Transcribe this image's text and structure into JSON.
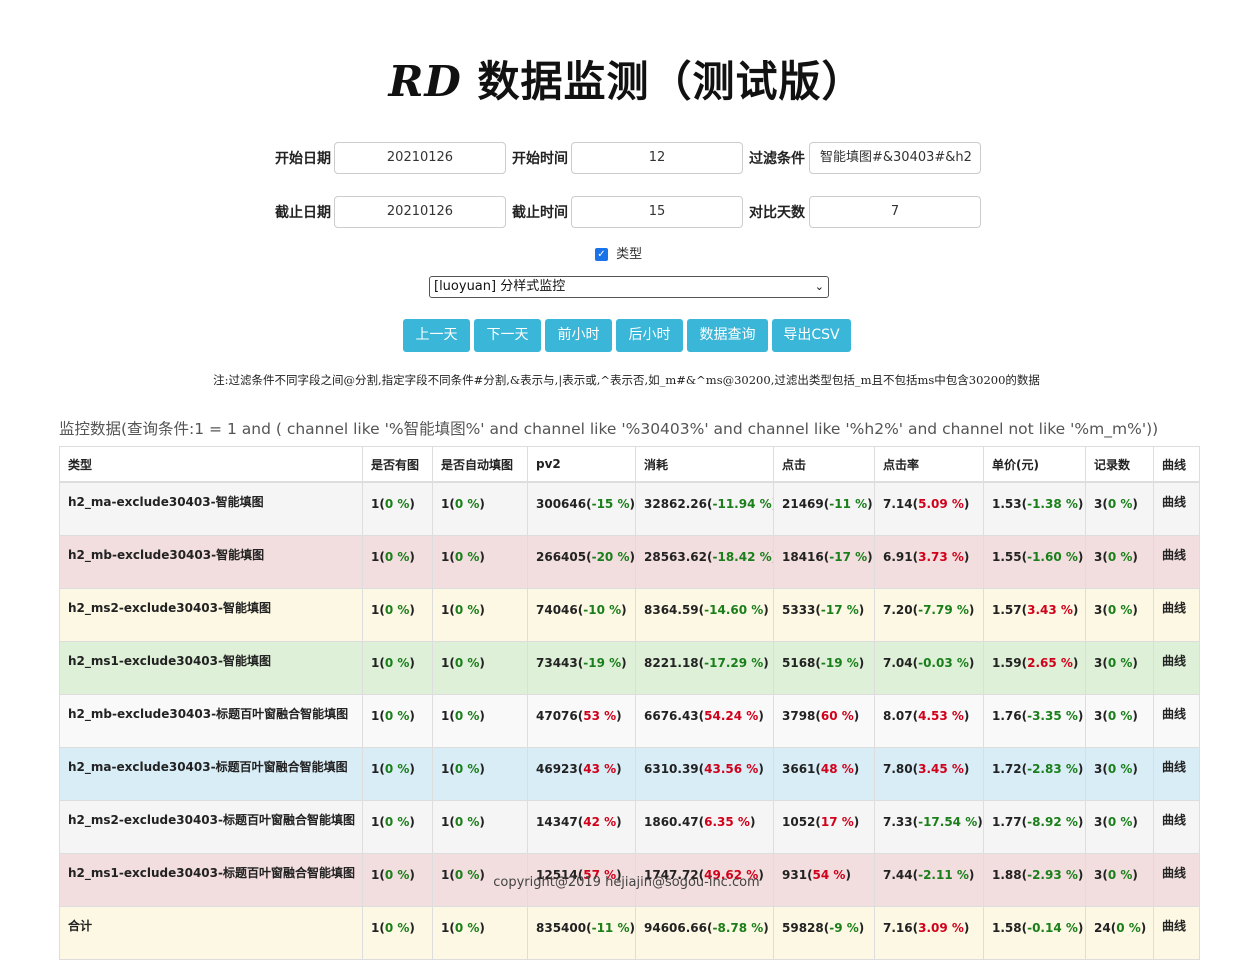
{
  "title": {
    "rd": "RD",
    "main": "数据监测（测试版）"
  },
  "form": {
    "start_date": {
      "label": "开始日期",
      "value": "20210126"
    },
    "start_time": {
      "label": "开始时间",
      "value": "12"
    },
    "filter": {
      "label": "过滤条件",
      "value": "智能填图#&30403#&h2"
    },
    "end_date": {
      "label": "截止日期",
      "value": "20210126"
    },
    "end_time": {
      "label": "截止时间",
      "value": "15"
    },
    "compare_days": {
      "label": "对比天数",
      "value": "7"
    },
    "type_checkbox": {
      "label": "类型",
      "checked": true
    },
    "select": {
      "value": "[luoyuan] 分样式监控"
    }
  },
  "buttons": {
    "prev_day": "上一天",
    "next_day": "下一天",
    "prev_hour": "前小时",
    "next_hour": "后小时",
    "query": "数据查询",
    "export": "导出CSV"
  },
  "note": "注:过滤条件不同字段之间@分割,指定字段不同条件#分割,&表示与,|表示或,^表示否,如_m#&^ms@30200,过滤出类型包括_m且不包括ms中包含30200的数据",
  "query_title": "监控数据(查询条件:1 = 1 and ( channel like '%智能填图%' and channel like '%30403%' and channel like '%h2%' and channel not like '%m_m%'))",
  "table": {
    "headers": [
      "类型",
      "是否有图",
      "是否自动填图",
      "pv2",
      "消耗",
      "点击",
      "点击率",
      "单价(元)",
      "记录数",
      "曲线"
    ],
    "rows": [
      {
        "type": "h2_ma-exclude30403-智能填图",
        "has_img": [
          "1",
          "0 %",
          "down"
        ],
        "auto_fill": [
          "1",
          "0 %",
          "down"
        ],
        "pv2": [
          "300646",
          "-15 %",
          "down"
        ],
        "cost": [
          "32862.26",
          "-11.94 %",
          "down"
        ],
        "click": [
          "21469",
          "-11 %",
          "down"
        ],
        "ctr": [
          "7.14",
          "5.09 %",
          "up"
        ],
        "price": [
          "1.53",
          "-1.38 %",
          "down"
        ],
        "records": [
          "3",
          "0 %",
          "down"
        ],
        "curve": "曲线"
      },
      {
        "type": "h2_mb-exclude30403-智能填图",
        "has_img": [
          "1",
          "0 %",
          "down"
        ],
        "auto_fill": [
          "1",
          "0 %",
          "down"
        ],
        "pv2": [
          "266405",
          "-20 %",
          "down"
        ],
        "cost": [
          "28563.62",
          "-18.42 %",
          "down"
        ],
        "click": [
          "18416",
          "-17 %",
          "down"
        ],
        "ctr": [
          "6.91",
          "3.73 %",
          "up"
        ],
        "price": [
          "1.55",
          "-1.60 %",
          "down"
        ],
        "records": [
          "3",
          "0 %",
          "down"
        ],
        "curve": "曲线"
      },
      {
        "type": "h2_ms2-exclude30403-智能填图",
        "has_img": [
          "1",
          "0 %",
          "down"
        ],
        "auto_fill": [
          "1",
          "0 %",
          "down"
        ],
        "pv2": [
          "74046",
          "-10 %",
          "down"
        ],
        "cost": [
          "8364.59",
          "-14.60 %",
          "down"
        ],
        "click": [
          "5333",
          "-17 %",
          "down"
        ],
        "ctr": [
          "7.20",
          "-7.79 %",
          "down"
        ],
        "price": [
          "1.57",
          "3.43 %",
          "up"
        ],
        "records": [
          "3",
          "0 %",
          "down"
        ],
        "curve": "曲线"
      },
      {
        "type": "h2_ms1-exclude30403-智能填图",
        "has_img": [
          "1",
          "0 %",
          "down"
        ],
        "auto_fill": [
          "1",
          "0 %",
          "down"
        ],
        "pv2": [
          "73443",
          "-19 %",
          "down"
        ],
        "cost": [
          "8221.18",
          "-17.29 %",
          "down"
        ],
        "click": [
          "5168",
          "-19 %",
          "down"
        ],
        "ctr": [
          "7.04",
          "-0.03 %",
          "down"
        ],
        "price": [
          "1.59",
          "2.65 %",
          "up"
        ],
        "records": [
          "3",
          "0 %",
          "down"
        ],
        "curve": "曲线"
      },
      {
        "type": "h2_mb-exclude30403-标题百叶窗融合智能填图",
        "has_img": [
          "1",
          "0 %",
          "down"
        ],
        "auto_fill": [
          "1",
          "0 %",
          "down"
        ],
        "pv2": [
          "47076",
          "53 %",
          "up"
        ],
        "cost": [
          "6676.43",
          "54.24 %",
          "up"
        ],
        "click": [
          "3798",
          "60 %",
          "up"
        ],
        "ctr": [
          "8.07",
          "4.53 %",
          "up"
        ],
        "price": [
          "1.76",
          "-3.35 %",
          "down"
        ],
        "records": [
          "3",
          "0 %",
          "down"
        ],
        "curve": "曲线"
      },
      {
        "type": "h2_ma-exclude30403-标题百叶窗融合智能填图",
        "has_img": [
          "1",
          "0 %",
          "down"
        ],
        "auto_fill": [
          "1",
          "0 %",
          "down"
        ],
        "pv2": [
          "46923",
          "43 %",
          "up"
        ],
        "cost": [
          "6310.39",
          "43.56 %",
          "up"
        ],
        "click": [
          "3661",
          "48 %",
          "up"
        ],
        "ctr": [
          "7.80",
          "3.45 %",
          "up"
        ],
        "price": [
          "1.72",
          "-2.83 %",
          "down"
        ],
        "records": [
          "3",
          "0 %",
          "down"
        ],
        "curve": "曲线"
      },
      {
        "type": "h2_ms2-exclude30403-标题百叶窗融合智能填图",
        "has_img": [
          "1",
          "0 %",
          "down"
        ],
        "auto_fill": [
          "1",
          "0 %",
          "down"
        ],
        "pv2": [
          "14347",
          "42 %",
          "up"
        ],
        "cost": [
          "1860.47",
          "6.35 %",
          "up"
        ],
        "click": [
          "1052",
          "17 %",
          "up"
        ],
        "ctr": [
          "7.33",
          "-17.54 %",
          "down"
        ],
        "price": [
          "1.77",
          "-8.92 %",
          "down"
        ],
        "records": [
          "3",
          "0 %",
          "down"
        ],
        "curve": "曲线"
      },
      {
        "type": "h2_ms1-exclude30403-标题百叶窗融合智能填图",
        "has_img": [
          "1",
          "0 %",
          "down"
        ],
        "auto_fill": [
          "1",
          "0 %",
          "down"
        ],
        "pv2": [
          "12514",
          "57 %",
          "up"
        ],
        "cost": [
          "1747.72",
          "49.62 %",
          "up"
        ],
        "click": [
          "931",
          "54 %",
          "up"
        ],
        "ctr": [
          "7.44",
          "-2.11 %",
          "down"
        ],
        "price": [
          "1.88",
          "-2.93 %",
          "down"
        ],
        "records": [
          "3",
          "0 %",
          "down"
        ],
        "curve": "曲线"
      },
      {
        "type": "合计",
        "has_img": [
          "1",
          "0 %",
          "down"
        ],
        "auto_fill": [
          "1",
          "0 %",
          "down"
        ],
        "pv2": [
          "835400",
          "-11 %",
          "down"
        ],
        "cost": [
          "94606.66",
          "-8.78 %",
          "down"
        ],
        "click": [
          "59828",
          "-9 %",
          "down"
        ],
        "ctr": [
          "7.16",
          "3.09 %",
          "up"
        ],
        "price": [
          "1.58",
          "-0.14 %",
          "down"
        ],
        "records": [
          "24",
          "0 %",
          "down"
        ],
        "curve": "曲线"
      }
    ]
  },
  "colors": {
    "up": "#d0021b",
    "down": "#1a7f1a",
    "button": "#3ab6d8",
    "link": "#337ab7"
  },
  "footer": "copyright@2019 hejiajin@sogou-inc.com"
}
